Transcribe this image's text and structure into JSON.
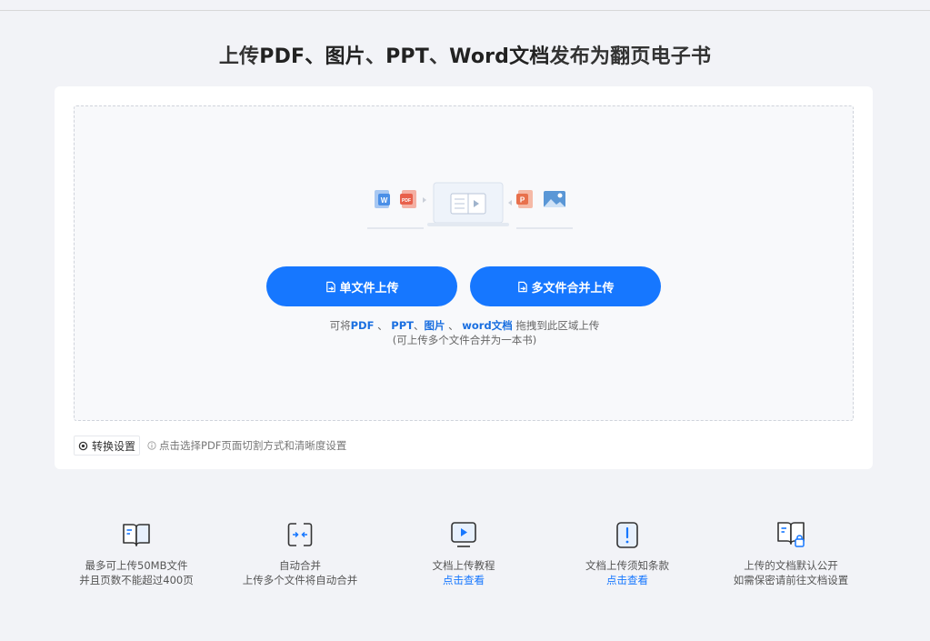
{
  "headline": {
    "p1": "上传",
    "p2": "PDF、图片",
    "p3": "、",
    "p4": "PPT",
    "p5": "、",
    "p6": "Word文档",
    "p7": "发布为翻页电子书"
  },
  "upload": {
    "single_button_label": "单文件上传",
    "multi_button_label": "多文件合并上传",
    "hint": {
      "prefix": "可将",
      "pdf": "PDF",
      "sep1": " 、",
      "ppt": "PPT",
      "sep2": "、",
      "image": "图片",
      "sep3": " 、",
      "word": "word文档",
      "suffix": " 拖拽到此区域上传",
      "line2": "(可上传多个文件合并为一本书)"
    }
  },
  "settings": {
    "button_label": "转换设置",
    "tip": "点击选择PDF页面切割方式和清晰度设置"
  },
  "features": [
    {
      "icon": "book-icon",
      "line1": "最多可上传50MB文件",
      "line2": "并且页数不能超过400页"
    },
    {
      "icon": "merge-icon",
      "line1": "自动合并",
      "line2": "上传多个文件将自动合并"
    },
    {
      "icon": "video-tutorial-icon",
      "line1": "文档上传教程",
      "link": "点击查看"
    },
    {
      "icon": "notice-icon",
      "line1": "文档上传须知条款",
      "link": "点击查看"
    },
    {
      "icon": "privacy-book-icon",
      "line1": "上传的文档默认公开",
      "line2": "如需保密请前往文档设置"
    }
  ],
  "colors": {
    "accent": "#1677ff",
    "background": "#f2f3f7",
    "word": "#4a8fe7",
    "pdf": "#e8604c",
    "ppt": "#e8704c"
  }
}
